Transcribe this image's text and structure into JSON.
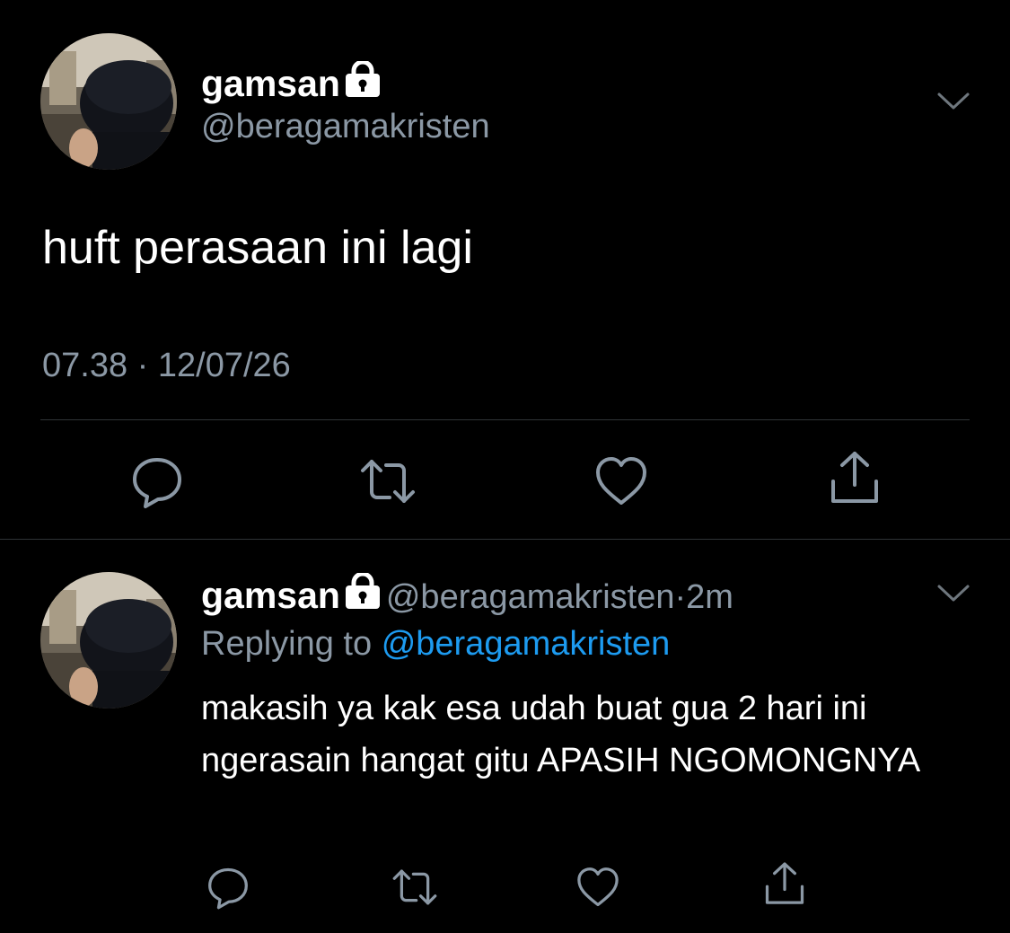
{
  "colors": {
    "background": "#000000",
    "primary_text": "#ffffff",
    "secondary_text": "#8b98a5",
    "link": "#1d9bf0",
    "divider": "#2f3336"
  },
  "main_tweet": {
    "author": {
      "display_name": "gamsan",
      "handle": "@beragamakristen",
      "protected_icon": "lock-icon"
    },
    "text": "huft perasaan ini lagi",
    "time": "07.38",
    "separator": "·",
    "date": "12/07/26",
    "menu_icon": "chevron-down-icon",
    "actions": [
      "reply-icon",
      "retweet-icon",
      "like-icon",
      "share-icon"
    ]
  },
  "reply_tweet": {
    "author": {
      "display_name": "gamsan",
      "handle": "@beragamakristen",
      "protected_icon": "lock-icon"
    },
    "separator": "·",
    "relative_time": "2m",
    "replying_to_label": "Replying to",
    "replying_to_handle": "@beragamakristen",
    "text": "makasih ya kak esa udah buat gua 2 hari ini ngerasain hangat gitu APASIH NGOMONGNYA",
    "menu_icon": "chevron-down-icon",
    "actions": [
      "reply-icon",
      "retweet-icon",
      "like-icon",
      "share-icon"
    ]
  }
}
